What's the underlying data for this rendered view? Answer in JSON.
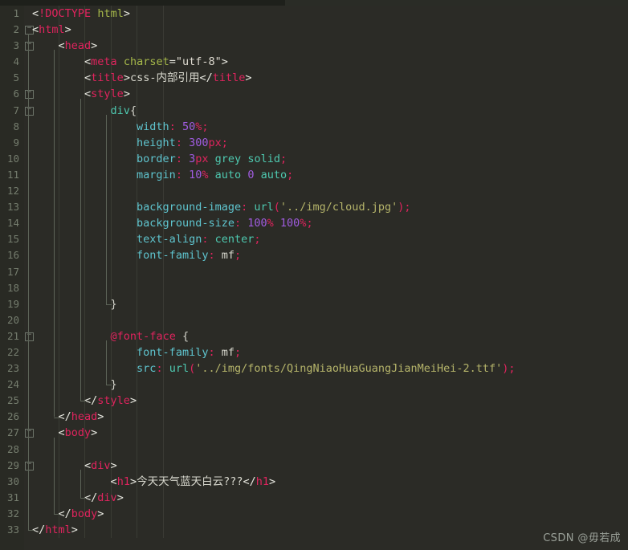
{
  "editor": {
    "theme_name": "dark-olive",
    "background_color": "#2b2b26",
    "gutter_color": "#292a24",
    "line_number_color": "#757d6e",
    "language": "html",
    "total_lines": 33,
    "fold_marker_glyph": "minus-square"
  },
  "colors": {
    "tag": "#e0245e",
    "attribute": "#a6b84a",
    "attribute_value": "#dedad0",
    "css_property": "#5fc5cf",
    "number": "#a05ce0",
    "unit": "#e0245e",
    "keyword": "#4ec9b0",
    "string": "#b5b46a",
    "punctuation": "#e8e8e0",
    "plain_text": "#d8d8ce"
  },
  "code": {
    "lines": [
      {
        "n": "1",
        "fold": false,
        "text": "<!DOCTYPE html>"
      },
      {
        "n": "2",
        "fold": true,
        "text": "<html>"
      },
      {
        "n": "3",
        "fold": true,
        "text": "    <head>"
      },
      {
        "n": "4",
        "fold": false,
        "text": "        <meta charset=\"utf-8\">"
      },
      {
        "n": "5",
        "fold": false,
        "text": "        <title>css-内部引用</title>"
      },
      {
        "n": "6",
        "fold": true,
        "text": "        <style>"
      },
      {
        "n": "7",
        "fold": true,
        "text": "            div{"
      },
      {
        "n": "8",
        "fold": false,
        "text": "                width: 50%;"
      },
      {
        "n": "9",
        "fold": false,
        "text": "                height: 300px;"
      },
      {
        "n": "10",
        "fold": false,
        "text": "                border: 3px grey solid;"
      },
      {
        "n": "11",
        "fold": false,
        "text": "                margin: 10% auto 0 auto;"
      },
      {
        "n": "12",
        "fold": false,
        "text": ""
      },
      {
        "n": "13",
        "fold": false,
        "text": "                background-image: url('../img/cloud.jpg');"
      },
      {
        "n": "14",
        "fold": false,
        "text": "                background-size: 100% 100%;"
      },
      {
        "n": "15",
        "fold": false,
        "text": "                text-align: center;"
      },
      {
        "n": "16",
        "fold": false,
        "text": "                font-family: mf;"
      },
      {
        "n": "17",
        "fold": false,
        "text": ""
      },
      {
        "n": "18",
        "fold": false,
        "text": ""
      },
      {
        "n": "19",
        "fold": false,
        "text": "            }"
      },
      {
        "n": "20",
        "fold": false,
        "text": ""
      },
      {
        "n": "21",
        "fold": true,
        "text": "            @font-face {"
      },
      {
        "n": "22",
        "fold": false,
        "text": "                font-family: mf;"
      },
      {
        "n": "23",
        "fold": false,
        "text": "                src: url('../img/fonts/QingNiaoHuaGuangJianMeiHei-2.ttf');"
      },
      {
        "n": "24",
        "fold": false,
        "text": "            }"
      },
      {
        "n": "25",
        "fold": false,
        "text": "        </style>"
      },
      {
        "n": "26",
        "fold": false,
        "text": "    </head>"
      },
      {
        "n": "27",
        "fold": true,
        "text": "    <body>"
      },
      {
        "n": "28",
        "fold": false,
        "text": ""
      },
      {
        "n": "29",
        "fold": true,
        "text": "        <div>"
      },
      {
        "n": "30",
        "fold": false,
        "text": "            <h1>今天天气蓝天白云???</h1>"
      },
      {
        "n": "31",
        "fold": false,
        "text": "        </div>"
      },
      {
        "n": "32",
        "fold": false,
        "text": "    </body>"
      },
      {
        "n": "33",
        "fold": false,
        "text": "</html>"
      }
    ],
    "tokens": [
      [
        [
          "punct",
          "<"
        ],
        [
          "tag",
          "!DOCTYPE"
        ],
        [
          "plain",
          " "
        ],
        [
          "attr",
          "html"
        ],
        [
          "punct",
          ">"
        ]
      ],
      [
        [
          "punct",
          "<"
        ],
        [
          "tag",
          "html"
        ],
        [
          "punct",
          ">"
        ]
      ],
      [
        [
          "plain",
          "    "
        ],
        [
          "punct",
          "<"
        ],
        [
          "tag",
          "head"
        ],
        [
          "punct",
          ">"
        ]
      ],
      [
        [
          "plain",
          "        "
        ],
        [
          "punct",
          "<"
        ],
        [
          "tag",
          "meta"
        ],
        [
          "plain",
          " "
        ],
        [
          "attr",
          "charset"
        ],
        [
          "punct",
          "="
        ],
        [
          "attrval",
          "\"utf-8\""
        ],
        [
          "punct",
          ">"
        ]
      ],
      [
        [
          "plain",
          "        "
        ],
        [
          "punct",
          "<"
        ],
        [
          "tag",
          "title"
        ],
        [
          "punct",
          ">"
        ],
        [
          "text",
          "css-内部引用"
        ],
        [
          "punct",
          "</"
        ],
        [
          "tag",
          "title"
        ],
        [
          "punct",
          ">"
        ]
      ],
      [
        [
          "plain",
          "        "
        ],
        [
          "punct",
          "<"
        ],
        [
          "tag",
          "style"
        ],
        [
          "punct",
          ">"
        ]
      ],
      [
        [
          "plain",
          "            "
        ],
        [
          "kw",
          "div"
        ],
        [
          "brace",
          "{"
        ]
      ],
      [
        [
          "plain",
          "                "
        ],
        [
          "prop",
          "width"
        ],
        [
          "unit",
          ":"
        ],
        [
          "plain",
          " "
        ],
        [
          "num",
          "50"
        ],
        [
          "unit",
          "%;"
        ]
      ],
      [
        [
          "plain",
          "                "
        ],
        [
          "prop",
          "height"
        ],
        [
          "unit",
          ":"
        ],
        [
          "plain",
          " "
        ],
        [
          "num",
          "300"
        ],
        [
          "unit",
          "px;"
        ]
      ],
      [
        [
          "plain",
          "                "
        ],
        [
          "prop",
          "border"
        ],
        [
          "unit",
          ":"
        ],
        [
          "plain",
          " "
        ],
        [
          "num",
          "3"
        ],
        [
          "unit",
          "px"
        ],
        [
          "plain",
          " "
        ],
        [
          "kw",
          "grey"
        ],
        [
          "plain",
          " "
        ],
        [
          "kw",
          "solid"
        ],
        [
          "unit",
          ";"
        ]
      ],
      [
        [
          "plain",
          "                "
        ],
        [
          "prop",
          "margin"
        ],
        [
          "unit",
          ":"
        ],
        [
          "plain",
          " "
        ],
        [
          "num",
          "10"
        ],
        [
          "unit",
          "%"
        ],
        [
          "plain",
          " "
        ],
        [
          "kw",
          "auto"
        ],
        [
          "plain",
          " "
        ],
        [
          "num",
          "0"
        ],
        [
          "plain",
          " "
        ],
        [
          "kw",
          "auto"
        ],
        [
          "unit",
          ";"
        ]
      ],
      [],
      [
        [
          "plain",
          "                "
        ],
        [
          "prop",
          "background-image"
        ],
        [
          "unit",
          ":"
        ],
        [
          "plain",
          " "
        ],
        [
          "func",
          "url"
        ],
        [
          "unit",
          "("
        ],
        [
          "string",
          "'../img/cloud.jpg'"
        ],
        [
          "unit",
          ");"
        ]
      ],
      [
        [
          "plain",
          "                "
        ],
        [
          "prop",
          "background-size"
        ],
        [
          "unit",
          ":"
        ],
        [
          "plain",
          " "
        ],
        [
          "num",
          "100"
        ],
        [
          "unit",
          "%"
        ],
        [
          "plain",
          " "
        ],
        [
          "num",
          "100"
        ],
        [
          "unit",
          "%;"
        ]
      ],
      [
        [
          "plain",
          "                "
        ],
        [
          "prop",
          "text-align"
        ],
        [
          "unit",
          ":"
        ],
        [
          "plain",
          " "
        ],
        [
          "kw",
          "center"
        ],
        [
          "unit",
          ";"
        ]
      ],
      [
        [
          "plain",
          "                "
        ],
        [
          "prop",
          "font-family"
        ],
        [
          "unit",
          ":"
        ],
        [
          "plain",
          " "
        ],
        [
          "plaintext",
          "mf"
        ],
        [
          "unit",
          ";"
        ]
      ],
      [],
      [],
      [
        [
          "plain",
          "            "
        ],
        [
          "brace",
          "}"
        ]
      ],
      [],
      [
        [
          "plain",
          "            "
        ],
        [
          "atrule",
          "@font-face"
        ],
        [
          "plain",
          " "
        ],
        [
          "brace",
          "{"
        ]
      ],
      [
        [
          "plain",
          "                "
        ],
        [
          "prop",
          "font-family"
        ],
        [
          "unit",
          ":"
        ],
        [
          "plain",
          " "
        ],
        [
          "plaintext",
          "mf"
        ],
        [
          "unit",
          ";"
        ]
      ],
      [
        [
          "plain",
          "                "
        ],
        [
          "prop",
          "src"
        ],
        [
          "unit",
          ":"
        ],
        [
          "plain",
          " "
        ],
        [
          "func",
          "url"
        ],
        [
          "unit",
          "("
        ],
        [
          "string",
          "'../img/fonts/QingNiaoHuaGuangJianMeiHei-2.ttf'"
        ],
        [
          "unit",
          ");"
        ]
      ],
      [
        [
          "plain",
          "            "
        ],
        [
          "brace",
          "}"
        ]
      ],
      [
        [
          "plain",
          "        "
        ],
        [
          "punct",
          "</"
        ],
        [
          "tag",
          "style"
        ],
        [
          "punct",
          ">"
        ]
      ],
      [
        [
          "plain",
          "    "
        ],
        [
          "punct",
          "</"
        ],
        [
          "tag",
          "head"
        ],
        [
          "punct",
          ">"
        ]
      ],
      [
        [
          "plain",
          "    "
        ],
        [
          "punct",
          "<"
        ],
        [
          "tag",
          "body"
        ],
        [
          "punct",
          ">"
        ]
      ],
      [],
      [
        [
          "plain",
          "        "
        ],
        [
          "punct",
          "<"
        ],
        [
          "tag",
          "div"
        ],
        [
          "punct",
          ">"
        ]
      ],
      [
        [
          "plain",
          "            "
        ],
        [
          "punct",
          "<"
        ],
        [
          "tag",
          "h1"
        ],
        [
          "punct",
          ">"
        ],
        [
          "text",
          "今天天气蓝天白云???"
        ],
        [
          "punct",
          "</"
        ],
        [
          "tag",
          "h1"
        ],
        [
          "punct",
          ">"
        ]
      ],
      [
        [
          "plain",
          "        "
        ],
        [
          "punct",
          "</"
        ],
        [
          "tag",
          "div"
        ],
        [
          "punct",
          ">"
        ]
      ],
      [
        [
          "plain",
          "    "
        ],
        [
          "punct",
          "</"
        ],
        [
          "tag",
          "body"
        ],
        [
          "punct",
          ">"
        ]
      ],
      [
        [
          "punct",
          "</"
        ],
        [
          "tag",
          "html"
        ],
        [
          "punct",
          ">"
        ]
      ]
    ]
  },
  "watermark": {
    "text": "CSDN @毋若成"
  }
}
